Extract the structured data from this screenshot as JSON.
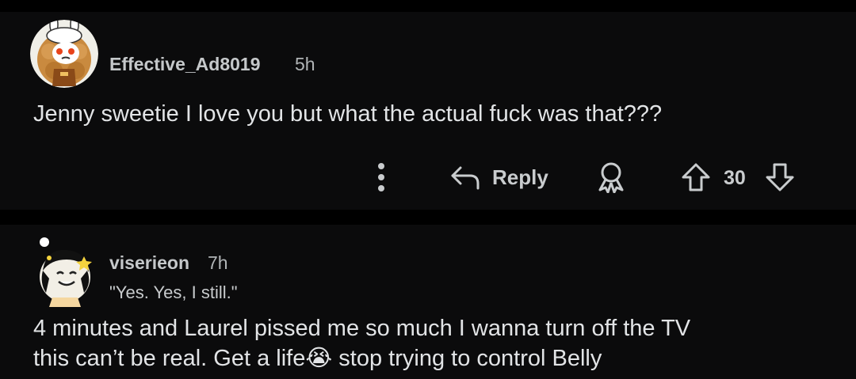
{
  "comments": [
    {
      "username": "Effective_Ad8019",
      "age": "5h",
      "body": "Jenny sweetie I love you but what the actual fuck was that???",
      "actions": {
        "reply_label": "Reply",
        "vote_count": "30"
      }
    },
    {
      "username": "viserieon",
      "age": "7h",
      "flair": "\"Yes. Yes, I still.\"",
      "body_line1": "4 minutes and Laurel pissed me so much I wanna turn off the TV",
      "body_line2_a": "this can’t be real. Get a life",
      "body_line2_emoji": "😭",
      "body_line2_b": " stop trying to control Belly"
    }
  ],
  "icons": [
    "more-icon",
    "reply-arrow-icon",
    "award-icon",
    "upvote-icon",
    "downvote-icon"
  ],
  "colors": {
    "background": "#000000",
    "card": "#0b0b0c",
    "text": "#e2e4e6",
    "muted": "#b0b4b6"
  }
}
